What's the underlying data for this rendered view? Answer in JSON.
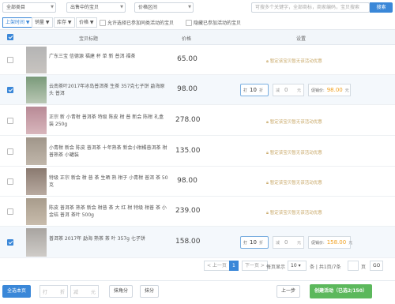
{
  "filters": {
    "category": "全部类目",
    "status": "出售中的宝贝",
    "price_range": "价格区间",
    "search_placeholder": "可搜多个关键字，全部商标，商家编码，宝贝搜索",
    "search_button": "搜索"
  },
  "sort": {
    "items": [
      {
        "label": "上架时间 ▼",
        "active": true
      },
      {
        "label": "销量 ▼",
        "active": false
      },
      {
        "label": "库存 ▼",
        "active": false
      },
      {
        "label": "价格 ▼",
        "active": false
      }
    ],
    "allow_joined": "允许选择已参加同类活动的宝贝",
    "hide_joined": "隐藏已参加活动的宝贝"
  },
  "header": {
    "product": "宝贝标题",
    "price": "价格",
    "settings": "设置"
  },
  "row_note": "暂定该宝贝暂无该活动优惠",
  "colors": {
    "thumb_palette": [
      "#8fa58f",
      "#b4c2b0",
      "#caa7ad",
      "#9a8a84",
      "#a49a8e",
      "#b8b0a6",
      "#c7c3c0"
    ]
  },
  "rows": [
    {
      "title": "广东三宝 信德源 福建 杯 单 新 普洱 福茶",
      "price": "65.00",
      "selected": false,
      "thumb": [
        "#b4b4b4",
        "#c8c4c0"
      ]
    },
    {
      "title": "云南茶叶2017年冰岛普洱茶 生茶 357克七子饼 勐海原头 普洱",
      "price": "98.00",
      "selected": true,
      "thumb": [
        "#7a9a7a",
        "#b9c7b4"
      ],
      "discount": "10",
      "discount_unit": "折",
      "minus": "0",
      "minus_unit": "元",
      "promo_label": "促销价:",
      "promo_price": "98.00",
      "promo_unit": "元"
    },
    {
      "title": "正宗 新 小青柑 普洱茶 特级 陈皮 柑 普 新会 陈柑 礼盒 装 250g",
      "price": "278.00",
      "selected": false,
      "thumb": [
        "#b88a96",
        "#d8b6bc"
      ]
    },
    {
      "title": "小青柑 新会 陈皮 普洱茶 十年熟茶 新会小柑橘普洱茶 柑普熟茶 小罐装",
      "price": "135.00",
      "selected": false,
      "thumb": [
        "#a0968a",
        "#c0b6aa"
      ]
    },
    {
      "title": "特级 正宗 新会 柑 普 茶 生晒 熟 柑子 小青柑 普洱 茶 50 克",
      "price": "98.00",
      "selected": false,
      "thumb": [
        "#8a7a70",
        "#b8aaa0"
      ]
    },
    {
      "title": "陈皮 普洱茶 熟茶 新会 柑普 茶 大 红 柑 特级 柑普 茶 小金桔 普洱 茶叶 500g",
      "price": "239.00",
      "selected": false,
      "thumb": [
        "#a89c8c",
        "#c8bcac"
      ]
    },
    {
      "title": "普洱茶 2017年 勐海 熟茶 茶 叶 357g 七子饼",
      "price": "158.00",
      "selected": true,
      "thumb": [
        "#a8a4a0",
        "#cfccc8"
      ],
      "discount": "10",
      "discount_unit": "折",
      "minus": "0",
      "minus_unit": "元",
      "promo_label": "促销价:",
      "promo_price": "158.00",
      "promo_unit": "元"
    }
  ],
  "pager": {
    "prev": "< 上一页",
    "page": "1",
    "next": "下一页 >",
    "per_page_label": "每页显示",
    "per_page": "10",
    "summary": "条 | 共1页/7条",
    "page_label": "页",
    "go": "GO"
  },
  "bottom": {
    "select_all": "全选本页",
    "discount_placeholder": "打",
    "discount_unit": "折",
    "minus_placeholder": "减",
    "minus_unit": "元",
    "round_angle": "抹角分",
    "round_cent": "抹分",
    "prev_step": "上一步",
    "create": "创建活动（已选2/150）"
  }
}
